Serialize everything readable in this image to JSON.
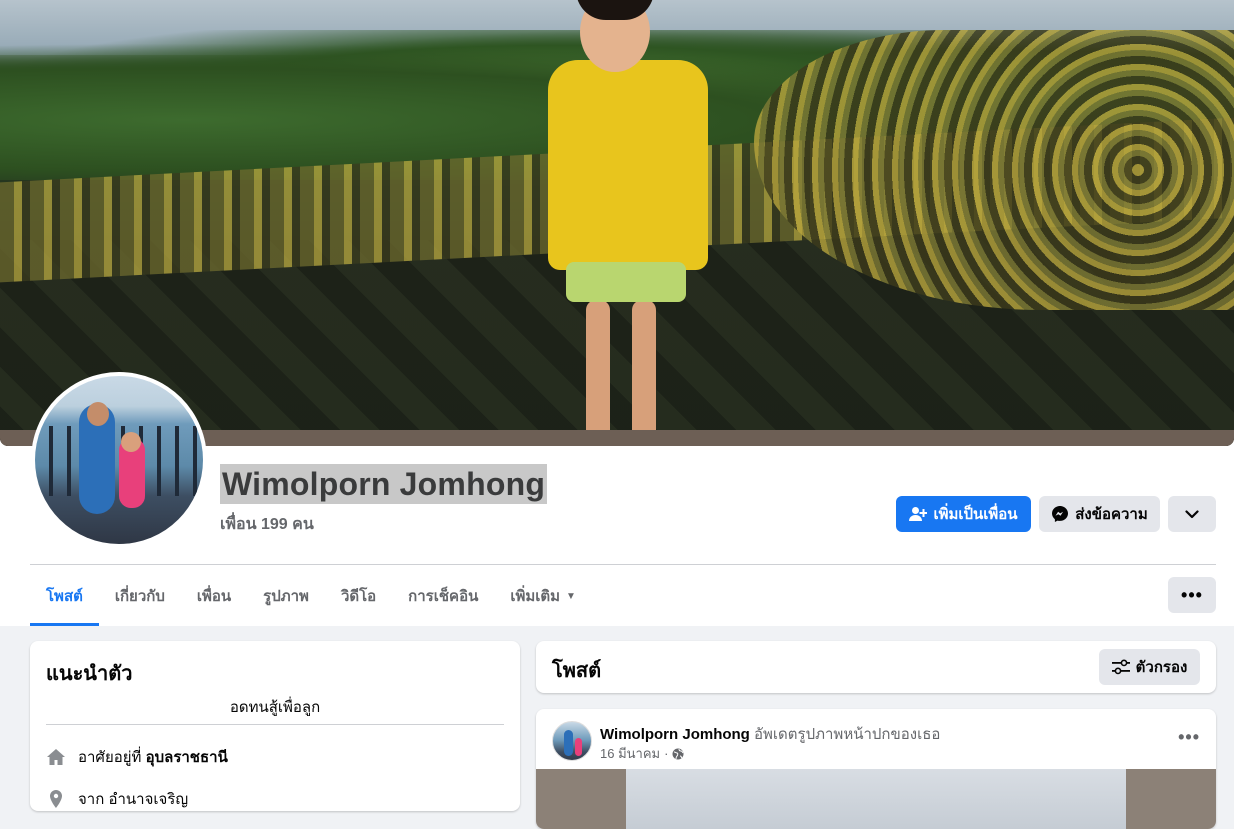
{
  "profile": {
    "name": "Wimolporn Jomhong",
    "friends": "เพื่อน 199 คน"
  },
  "actions": {
    "add_friend": "เพิ่มเป็นเพื่อน",
    "message": "ส่งข้อความ",
    "more_icon": "chevron-down-icon"
  },
  "tabs": [
    {
      "label": "โพสต์",
      "active": true
    },
    {
      "label": "เกี่ยวกับ"
    },
    {
      "label": "เพื่อน"
    },
    {
      "label": "รูปภาพ"
    },
    {
      "label": "วิดีโอ"
    },
    {
      "label": "การเช็คอิน"
    },
    {
      "label": "เพิ่มเติม"
    }
  ],
  "tab_more_icon": "ellipsis-icon",
  "intro": {
    "title": "แนะนำตัว",
    "bio": "อดทนสู้เพื่อลูก",
    "lives_prefix": "อาศัยอยู่ที่",
    "lives_city": "อุบลราชธานี",
    "from_text": "จาก อำนาจเจริญ"
  },
  "posts": {
    "title": "โพสต์",
    "filter_label": "ตัวกรอง"
  },
  "post": {
    "author": "Wimolporn Jomhong",
    "action": "อัพเดตรูปภาพหน้าปกของเธอ",
    "date": "16 มีนาคม",
    "sep": "·"
  },
  "colors": {
    "accent": "#1877f2",
    "background": "#f0f2f5",
    "button_gray": "#e4e6eb"
  }
}
